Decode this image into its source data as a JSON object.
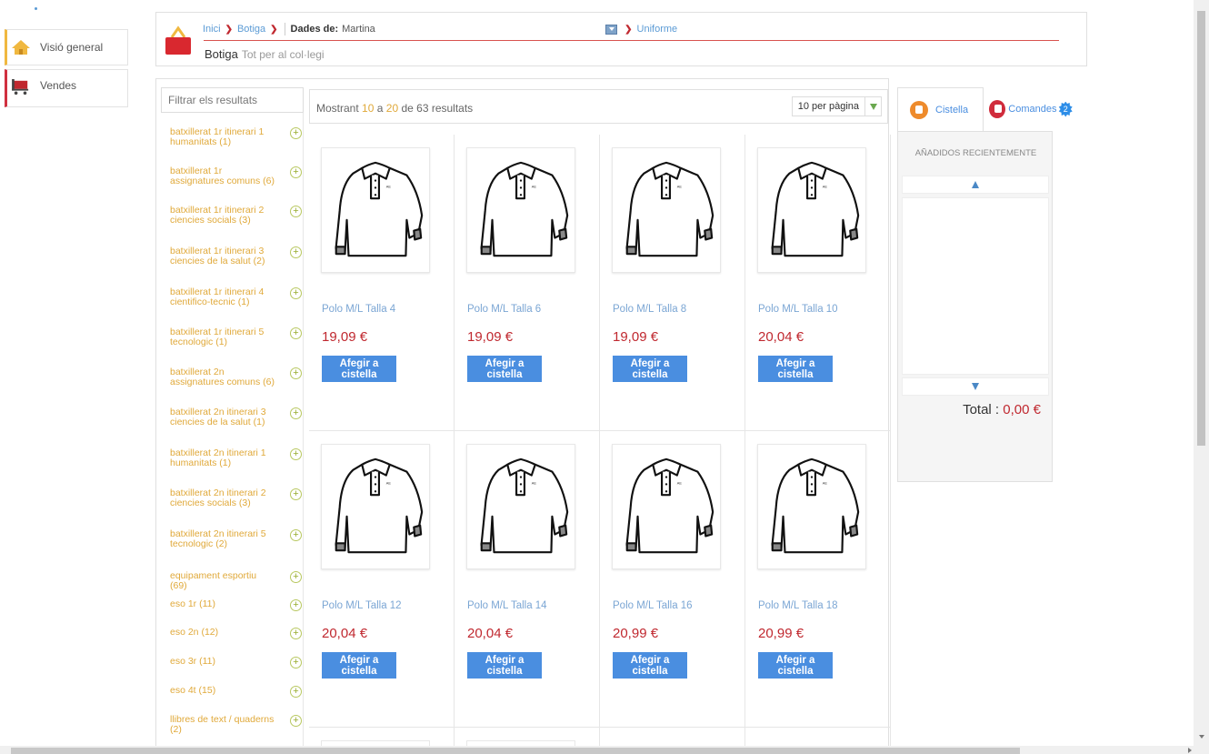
{
  "nav": {
    "items": [
      {
        "label": "Visió general",
        "icon": "home-icon"
      },
      {
        "label": "Vendes",
        "icon": "cart-icon"
      }
    ]
  },
  "header": {
    "breadcrumb": {
      "home": "Inici",
      "shop": "Botiga",
      "data_label": "Dades de:",
      "student": "Martina",
      "section": "Uniforme"
    },
    "title": "Botiga",
    "subtitle": "Tot per al col·legi"
  },
  "filters": {
    "placeholder": "Filtrar els resultats",
    "items": [
      "batxillerat 1r itinerari 1 humanitats (1)",
      "batxillerat 1r assignatures comuns (6)",
      "batxillerat 1r itinerari 2 ciencies socials (3)",
      "batxillerat 1r itinerari 3 ciencies de la salut (2)",
      "batxillerat 1r itinerari 4 cientifico-tecnic (1)",
      "batxillerat 1r itinerari 5 tecnologic (1)",
      "batxillerat 2n assignatures comuns (6)",
      "batxillerat 2n itinerari 3 ciencies de la salut (1)",
      "batxillerat 2n itinerari 1 humanitats (1)",
      "batxillerat 2n itinerari 2 ciencies socials (3)",
      "batxillerat 2n itinerari 5 tecnologic (2)",
      "equipament esportiu (69)",
      "eso 1r (11)",
      "eso 2n (12)",
      "eso 3r (11)",
      "eso 4t (15)",
      "llibres de text / quaderns (2)"
    ]
  },
  "results": {
    "prefix": "Mostrant",
    "from": "10",
    "mid": "a",
    "to": "20",
    "suffix": "de 63 resultats",
    "per_page": "10 per pàgina"
  },
  "products": [
    {
      "name": "Polo M/L Talla 4",
      "price": "19,09 €",
      "button": "Afegir a cistella"
    },
    {
      "name": "Polo M/L Talla 6",
      "price": "19,09 €",
      "button": "Afegir a cistella"
    },
    {
      "name": "Polo M/L Talla 8",
      "price": "19,09 €",
      "button": "Afegir a cistella"
    },
    {
      "name": "Polo M/L Talla 10",
      "price": "20,04 €",
      "button": "Afegir a cistella"
    },
    {
      "name": "Polo M/L Talla 12",
      "price": "20,04 €",
      "button": "Afegir a cistella"
    },
    {
      "name": "Polo M/L Talla 14",
      "price": "20,04 €",
      "button": "Afegir a cistella"
    },
    {
      "name": "Polo M/L Talla 16",
      "price": "20,99 €",
      "button": "Afegir a cistella"
    },
    {
      "name": "Polo M/L Talla 18",
      "price": "20,99 €",
      "button": "Afegir a cistella"
    }
  ],
  "cart": {
    "tab_cart": "Cistella",
    "tab_orders": "Comandes",
    "orders_badge": "2",
    "recent": "AÑADIDOS RECIENTEMENTE",
    "total_label": "Total :",
    "total_value": "0,00 €"
  },
  "colors": {
    "accent_blue": "#4a8ee0",
    "price_red": "#c0282f",
    "filter_orange": "#e0a93a"
  }
}
